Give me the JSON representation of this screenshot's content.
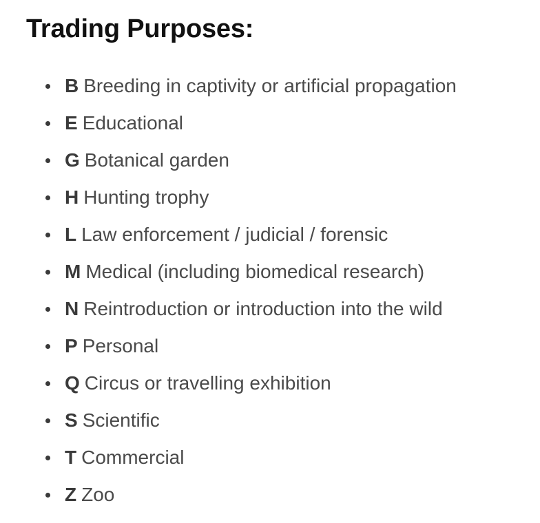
{
  "heading": "Trading Purposes:",
  "purposes": [
    {
      "code": "B",
      "label": "Breeding in captivity or artificial propagation"
    },
    {
      "code": "E",
      "label": "Educational"
    },
    {
      "code": "G",
      "label": "Botanical garden"
    },
    {
      "code": "H",
      "label": "Hunting trophy"
    },
    {
      "code": "L",
      "label": "Law enforcement / judicial / forensic"
    },
    {
      "code": "M",
      "label": "Medical (including biomedical research)"
    },
    {
      "code": "N",
      "label": "Reintroduction or introduction into the wild"
    },
    {
      "code": "P",
      "label": "Personal"
    },
    {
      "code": "Q",
      "label": "Circus or travelling exhibition"
    },
    {
      "code": "S",
      "label": "Scientific"
    },
    {
      "code": "T",
      "label": "Commercial"
    },
    {
      "code": "Z",
      "label": "Zoo"
    }
  ]
}
